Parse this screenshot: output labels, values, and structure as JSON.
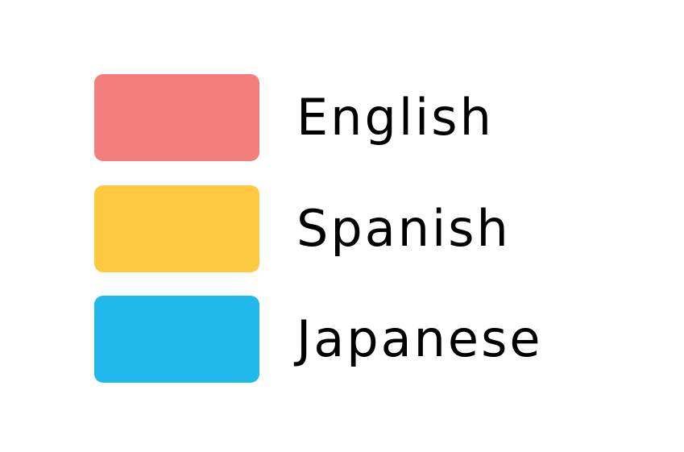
{
  "chart_data": {
    "type": "bar",
    "legend": {
      "placement": "center",
      "entries": [
        {
          "label": "English",
          "color": "#F47E7E"
        },
        {
          "label": "Spanish",
          "color": "#FEC840"
        },
        {
          "label": "Japanese",
          "color": "#21B8EC"
        }
      ]
    }
  }
}
